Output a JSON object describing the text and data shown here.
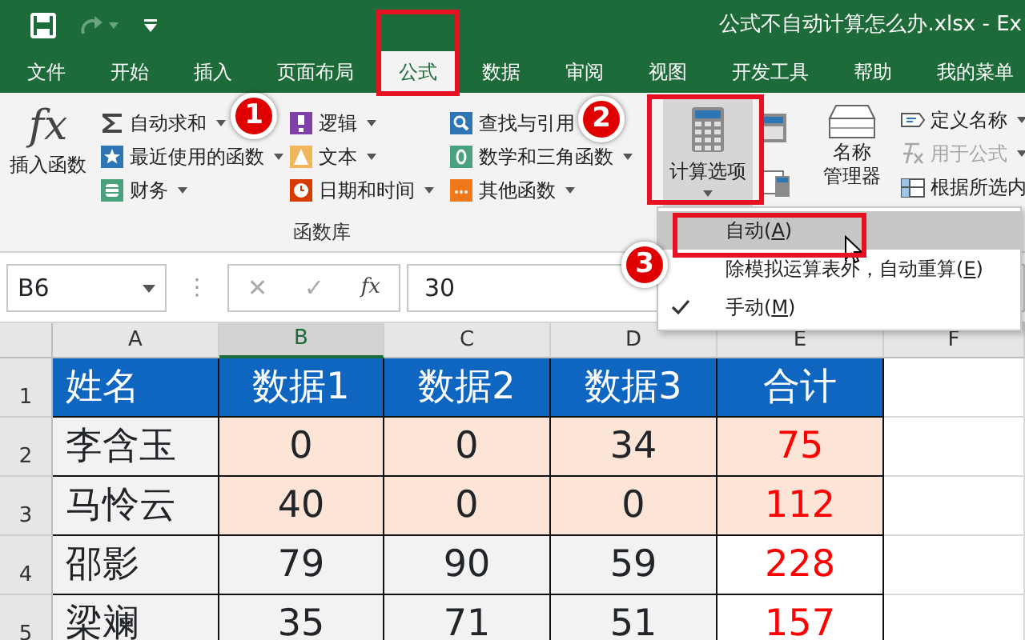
{
  "title_bar": {
    "title": "公式不自动计算怎么办.xlsx  -  Ex"
  },
  "tabs": [
    {
      "label": "文件",
      "selected": false
    },
    {
      "label": "开始",
      "selected": false
    },
    {
      "label": "插入",
      "selected": false
    },
    {
      "label": "页面布局",
      "selected": false
    },
    {
      "label": "公式",
      "selected": true
    },
    {
      "label": "数据",
      "selected": false
    },
    {
      "label": "审阅",
      "selected": false
    },
    {
      "label": "视图",
      "selected": false
    },
    {
      "label": "开发工具",
      "selected": false
    },
    {
      "label": "帮助",
      "selected": false
    },
    {
      "label": "我的菜单",
      "selected": false
    }
  ],
  "ribbon": {
    "insert_function": {
      "icon_text": "fx",
      "label": "插入函数"
    },
    "function_columns": [
      [
        {
          "label": "自动求和",
          "dropdown": true
        },
        {
          "label": "最近使用的函数",
          "dropdown": true
        },
        {
          "label": "财务",
          "dropdown": true
        }
      ],
      [
        {
          "label": "逻辑",
          "dropdown": true
        },
        {
          "label": "文本",
          "dropdown": true
        },
        {
          "label": "日期和时间",
          "dropdown": true
        }
      ],
      [
        {
          "label": "查找与引用",
          "dropdown": false
        },
        {
          "label": "数学和三角函数",
          "dropdown": true
        },
        {
          "label": "其他函数",
          "dropdown": true
        }
      ]
    ],
    "group_label": "函数库",
    "calc_options": {
      "label": "计算选项",
      "pressed": true
    },
    "name_manager": {
      "lines": [
        "名称",
        "管理器"
      ]
    },
    "defined_names": [
      {
        "label": "定义名称",
        "dropdown": true,
        "disabled": false
      },
      {
        "label": "用于公式",
        "dropdown": true,
        "disabled": true
      },
      {
        "label": "根据所选内",
        "dropdown": false,
        "disabled": false
      }
    ]
  },
  "formula_bar": {
    "name_box": "B6",
    "separator": "⋮",
    "cancel": "✕",
    "enter": "✓",
    "fx": "fx",
    "value": "30"
  },
  "calc_menu": [
    {
      "before": "自动(",
      "key": "A",
      "after": ")",
      "selected": true,
      "checked": false
    },
    {
      "before": "除模拟运算表外，自动重算(",
      "key": "E",
      "after": ")",
      "selected": false,
      "checked": false
    },
    {
      "before": "手动(",
      "key": "M",
      "after": ")",
      "selected": false,
      "checked": true
    }
  ],
  "sheet": {
    "columns": [
      {
        "label": "A",
        "selected": false
      },
      {
        "label": "B",
        "selected": true
      },
      {
        "label": "C",
        "selected": false
      },
      {
        "label": "D",
        "selected": false
      },
      {
        "label": "E",
        "selected": false
      },
      {
        "label": "F",
        "selected": false
      }
    ],
    "header_row": {
      "number": "1",
      "cells": [
        "姓名",
        "数据1",
        "数据2",
        "数据3",
        "合计"
      ]
    },
    "rows": [
      {
        "number": "2",
        "cells": [
          "李含玉",
          "0",
          "0",
          "34",
          "75"
        ],
        "highlighted": true
      },
      {
        "number": "3",
        "cells": [
          "马怜云",
          "40",
          "0",
          "0",
          "112"
        ],
        "highlighted": true
      },
      {
        "number": "4",
        "cells": [
          "邵影",
          "79",
          "90",
          "59",
          "228"
        ],
        "highlighted": false
      },
      {
        "number": "5",
        "cells": [
          "梁斓",
          "35",
          "71",
          "51",
          "157"
        ],
        "highlighted": false
      }
    ]
  },
  "callouts": [
    "1",
    "2",
    "3"
  ]
}
